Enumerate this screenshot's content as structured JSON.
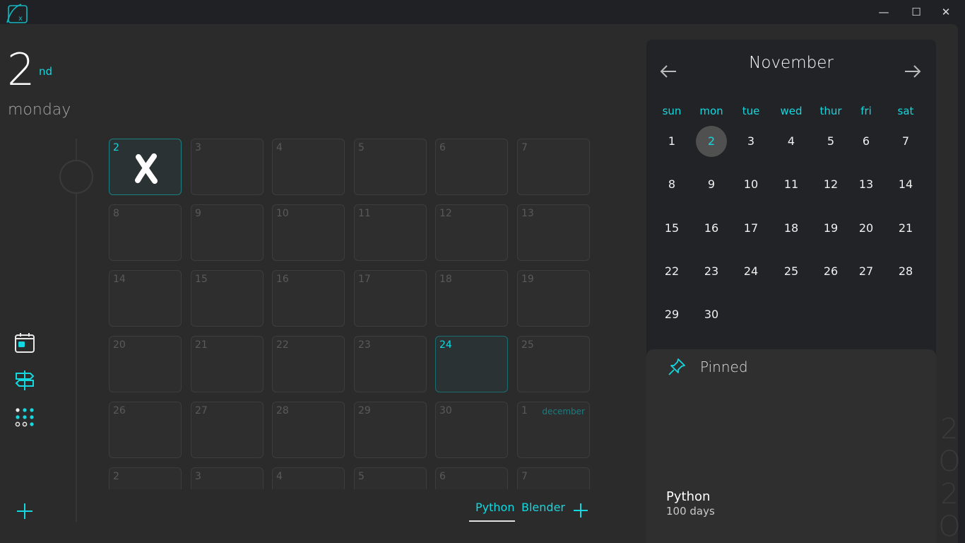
{
  "window": {
    "minimize": "—",
    "maximize": "☐",
    "close": "✕"
  },
  "header": {
    "day_number": "2",
    "day_suffix": "nd",
    "weekday": "monday"
  },
  "tracker_grid": {
    "rows": [
      [
        {
          "n": "2",
          "state": "today-x"
        },
        {
          "n": "3"
        },
        {
          "n": "4"
        },
        {
          "n": "5"
        },
        {
          "n": "6"
        },
        {
          "n": "7"
        }
      ],
      [
        {
          "n": "8"
        },
        {
          "n": "9"
        },
        {
          "n": "10"
        },
        {
          "n": "11"
        },
        {
          "n": "12"
        },
        {
          "n": "13"
        }
      ],
      [
        {
          "n": "14"
        },
        {
          "n": "15"
        },
        {
          "n": "16"
        },
        {
          "n": "17"
        },
        {
          "n": "18"
        },
        {
          "n": "19"
        }
      ],
      [
        {
          "n": "20"
        },
        {
          "n": "21"
        },
        {
          "n": "22"
        },
        {
          "n": "23"
        },
        {
          "n": "24",
          "state": "marked"
        },
        {
          "n": "25"
        }
      ],
      [
        {
          "n": "26"
        },
        {
          "n": "27"
        },
        {
          "n": "28"
        },
        {
          "n": "29"
        },
        {
          "n": "30"
        },
        {
          "n": "1",
          "tag": "december"
        }
      ],
      [
        {
          "n": "2"
        },
        {
          "n": "3"
        },
        {
          "n": "4"
        },
        {
          "n": "5"
        },
        {
          "n": "6"
        },
        {
          "n": "7"
        }
      ]
    ]
  },
  "habit_tabs": {
    "items": [
      "Python",
      "Blender"
    ],
    "active": "Python"
  },
  "calendar": {
    "month": "November",
    "weekdays": [
      "sun",
      "mon",
      "tue",
      "wed",
      "thur",
      "fri",
      "sat"
    ],
    "weeks": [
      [
        "1",
        "2",
        "3",
        "4",
        "5",
        "6",
        "7"
      ],
      [
        "8",
        "9",
        "10",
        "11",
        "12",
        "13",
        "14"
      ],
      [
        "15",
        "16",
        "17",
        "18",
        "19",
        "20",
        "21"
      ],
      [
        "22",
        "23",
        "24",
        "25",
        "26",
        "27",
        "28"
      ],
      [
        "29",
        "30",
        "",
        "",
        "",
        "",
        ""
      ]
    ],
    "selected": "2"
  },
  "pinned": {
    "title": "Pinned",
    "items": [
      {
        "name": "Python",
        "subtitle": "100 days"
      }
    ]
  },
  "year_digits": [
    "2",
    "O",
    "2",
    "O"
  ],
  "colors": {
    "accent": "#13d8e0",
    "background": "#2b2b2b",
    "panel": "#222326"
  }
}
